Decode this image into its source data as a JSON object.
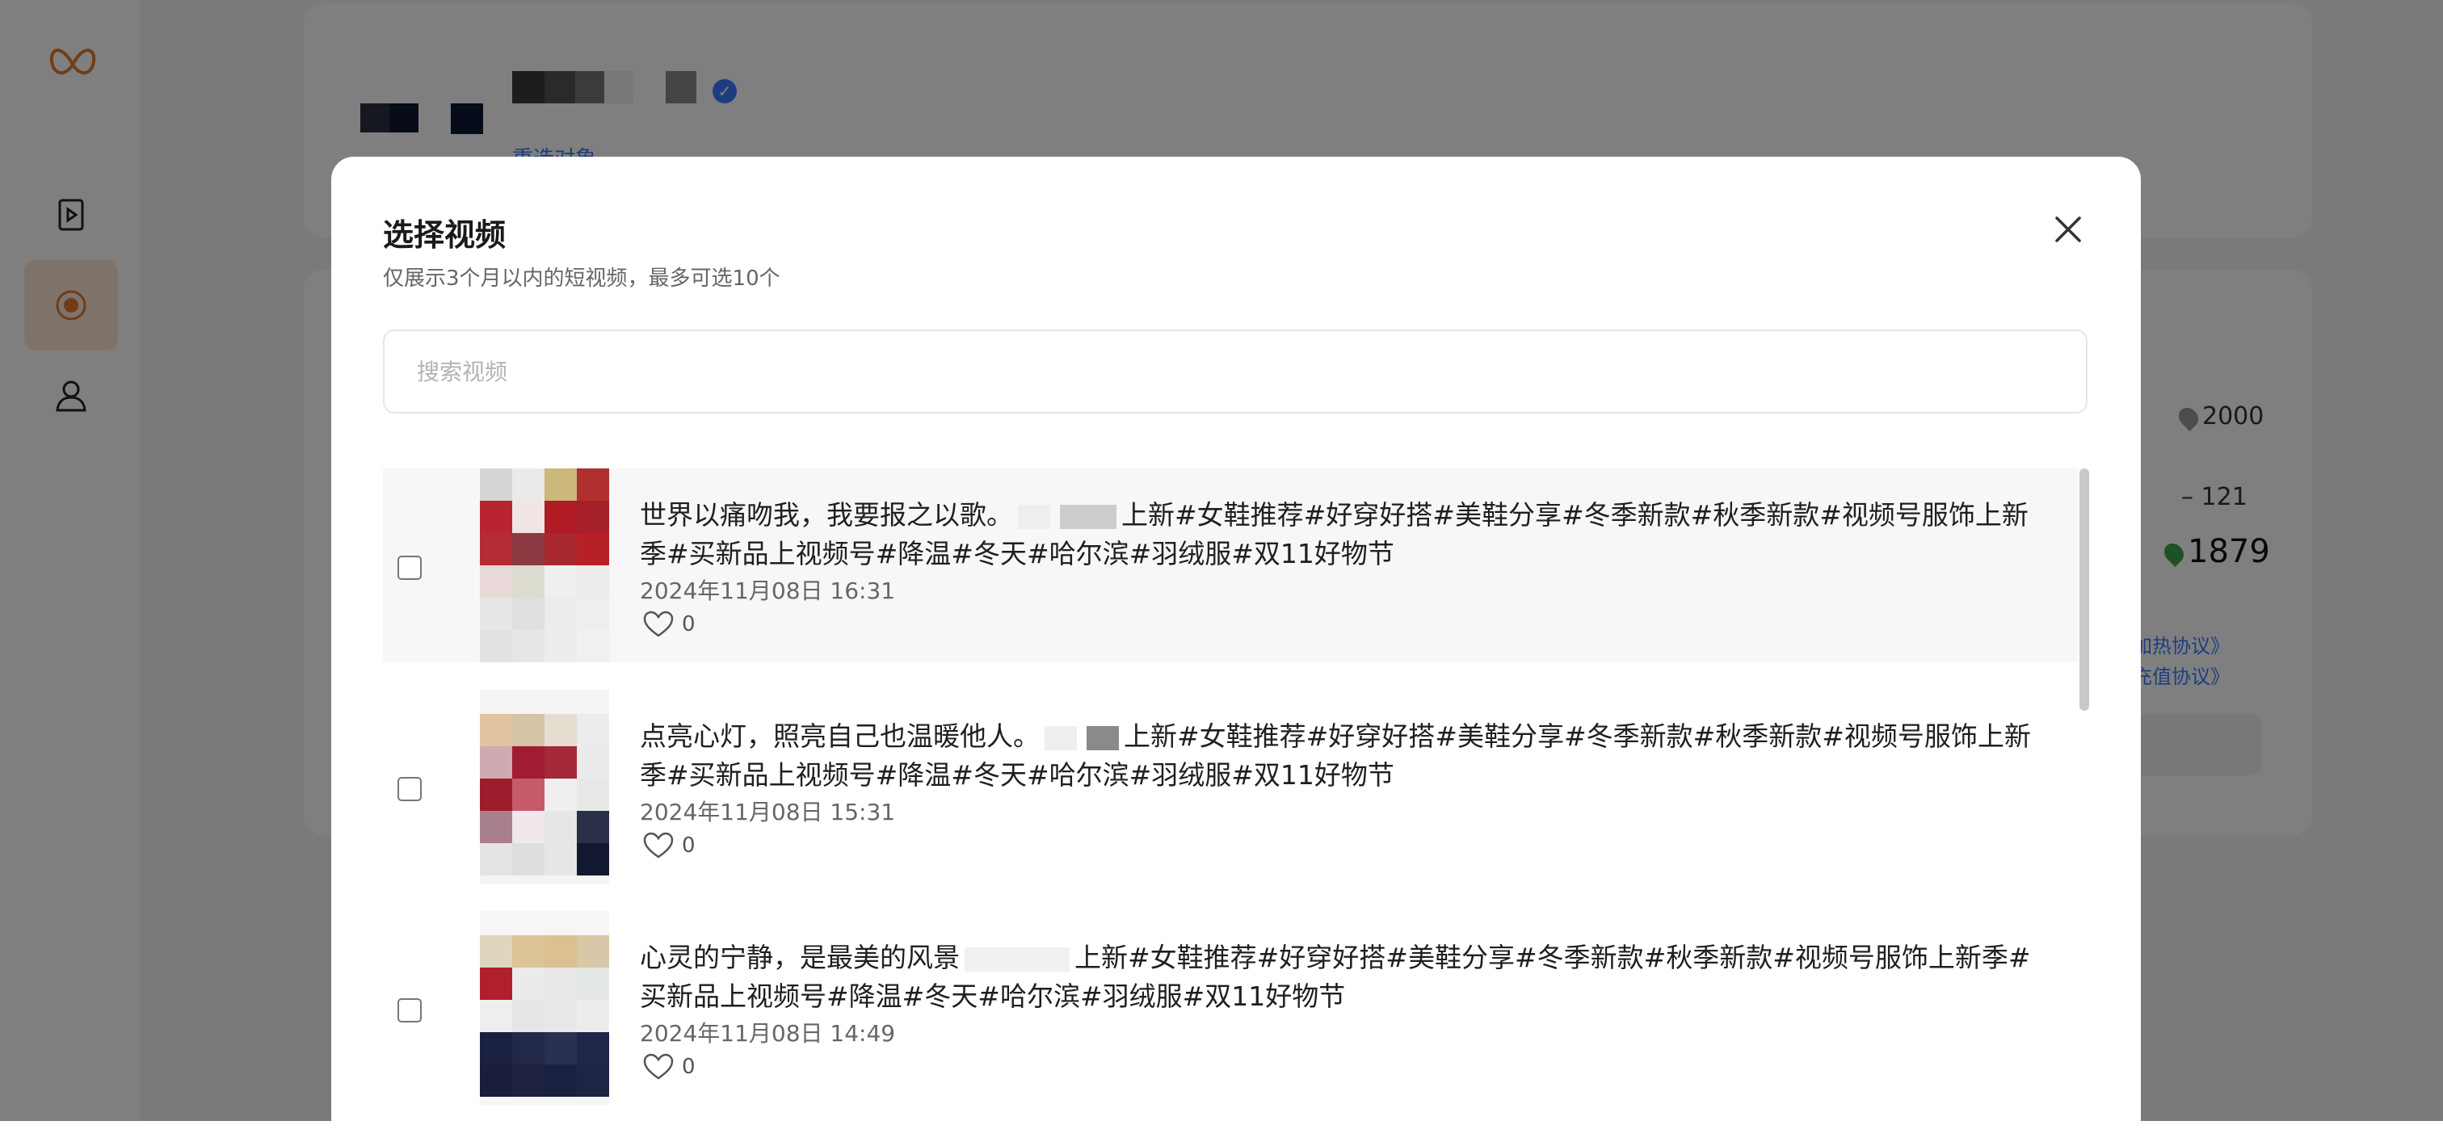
{
  "modal": {
    "title": "选择视频",
    "subtitle": "仅展示3个月以内的短视频，最多可选10个",
    "search_placeholder": "搜索视频",
    "videos": [
      {
        "caption": "世界以痛吻我，我要报之以歌。",
        "tags": "上新#女鞋推荐#好穿好搭#美鞋分享#冬季新款#秋季新款#视频号服饰上新季#买新品上视频号#降温#冬天#哈尔滨#羽绒服#双11好物节",
        "date": "2024年11月08日 16:31",
        "likes": "0"
      },
      {
        "caption": "点亮心灯，照亮自己也温暖他人。",
        "tags": "上新#女鞋推荐#好穿好搭#美鞋分享#冬季新款#秋季新款#视频号服饰上新季#买新品上视频号#降温#冬天#哈尔滨#羽绒服#双11好物节",
        "date": "2024年11月08日 15:31",
        "likes": "0"
      },
      {
        "caption": "心灵的宁静，是最美的风景",
        "tags": "上新#女鞋推荐#好穿好搭#美鞋分享#冬季新款#秋季新款#视频号服饰上新季#买新品上视频号#降温#冬天#哈尔滨#羽绒服#双11好物节",
        "date": "2024年11月08日 14:49",
        "likes": "0"
      }
    ]
  },
  "background": {
    "reselect_label": "重选对象",
    "balance_total": "2000",
    "deduction": "– 121",
    "remaining": "1879",
    "agreement_1": "加热协议》",
    "agreement_2": "充值协议》"
  },
  "colors": {
    "accent": "#3a7afe",
    "brand": "#e07a2e",
    "overlay": "rgba(0,0,0,0.5)",
    "like_icon": "#555555"
  },
  "icons": {
    "logo": "butterfly-logo-icon",
    "nav": [
      "video-play-icon",
      "live-record-icon",
      "user-icon"
    ],
    "close": "close-icon",
    "like": "heart-outline-icon",
    "verified": "verified-check-icon",
    "coin": "leaf-coin-icon"
  }
}
